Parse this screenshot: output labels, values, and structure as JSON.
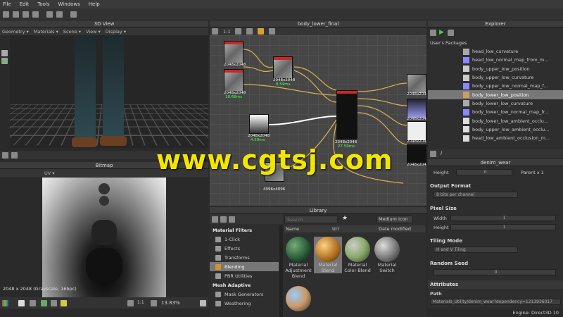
{
  "menu": [
    "File",
    "Edit",
    "Tools",
    "Windows",
    "Help"
  ],
  "view3d": {
    "title": "3D View",
    "toolbar": [
      "Geometry ▾",
      "Materials ▾",
      "Scene ▾",
      "View ▾",
      "Display ▾"
    ]
  },
  "bitmap": {
    "title": "Bitmap",
    "uv_label": "UV ▾",
    "status": "2048 x 2048 (Grayscale, 16bpc)",
    "zoom": "13.83%",
    "ratio": "1:1"
  },
  "graph": {
    "title": "body_lower_final",
    "ratio": "1:1",
    "nodes": [
      {
        "size": "2048x2048",
        "time": ""
      },
      {
        "size": "2048x2048",
        "time": "18.68ms"
      },
      {
        "size": "2048x2048",
        "time": "8.59ms"
      },
      {
        "size": "2048x2048",
        "time": "4.59ms"
      },
      {
        "size": "2048x2048",
        "time": "27.50ms"
      },
      {
        "size": "4096x4096",
        "time": "..."
      }
    ],
    "right_labels": [
      "2048x2048",
      "2048x2048",
      "2048x2048",
      "2048x2048"
    ]
  },
  "watermark": "www.cgtsj.com",
  "explorer": {
    "title": "Explorer",
    "packages_label": "User's Packages",
    "items": [
      {
        "label": "head_low_curvature",
        "selected": false
      },
      {
        "label": "head_low_normal_map_from_m...",
        "selected": false
      },
      {
        "label": "body_upper_low_position",
        "selected": false
      },
      {
        "label": "body_upper_low_curvature",
        "selected": false
      },
      {
        "label": "body_upper_low_normal_map_f...",
        "selected": false
      },
      {
        "label": "body_lower_low_position",
        "selected": true
      },
      {
        "label": "body_lower_low_curvature",
        "selected": false
      },
      {
        "label": "body_lower_low_normal_map_fr...",
        "selected": false
      },
      {
        "label": "body_lower_low_ambient_occlu...",
        "selected": false
      },
      {
        "label": "body_upper_low_ambient_occlu...",
        "selected": false
      },
      {
        "label": "head_low_ambient_occlusion_m...",
        "selected": false
      }
    ]
  },
  "properties": {
    "title": "denim_wear",
    "height_label": "Height",
    "height_value": "0",
    "parent_label": "Parent x 1",
    "output_format": "Output Format",
    "output_value": "8 bits per channel",
    "pixel_size": "Pixel Size",
    "width_label": "Width",
    "width_value": "1",
    "height2_label": "Height",
    "height2_value": "1",
    "tiling_mode": "Tiling Mode",
    "tiling_value": "H and V Tiling",
    "random_seed": "Random Seed",
    "seed_value": "0",
    "attributes": "Attributes",
    "path_label": "Path",
    "path_value": "Materials_Utility/denim_wear?dependency=1213936017"
  },
  "library": {
    "title": "Library",
    "search_placeholder": "Search",
    "view_mode": "Medium Icon",
    "columns": [
      "Name",
      "Url",
      "Date modified"
    ],
    "categories": [
      {
        "label": "Material Filters",
        "type": "hd"
      },
      {
        "label": "1-Click",
        "type": ""
      },
      {
        "label": "Effects",
        "type": ""
      },
      {
        "label": "Transforms",
        "type": ""
      },
      {
        "label": "Blending",
        "type": "sel"
      },
      {
        "label": "PBR Utilities",
        "type": ""
      },
      {
        "label": "Mesh Adaptive",
        "type": "hd"
      },
      {
        "label": "Mask Generators",
        "type": ""
      },
      {
        "label": "Weathering",
        "type": ""
      }
    ],
    "materials": [
      "Material Adjustment Blend",
      "Material Blend",
      "Material Color Blend",
      "Material Switch"
    ]
  },
  "status": {
    "engine": "Engine: Direct3D 10"
  }
}
